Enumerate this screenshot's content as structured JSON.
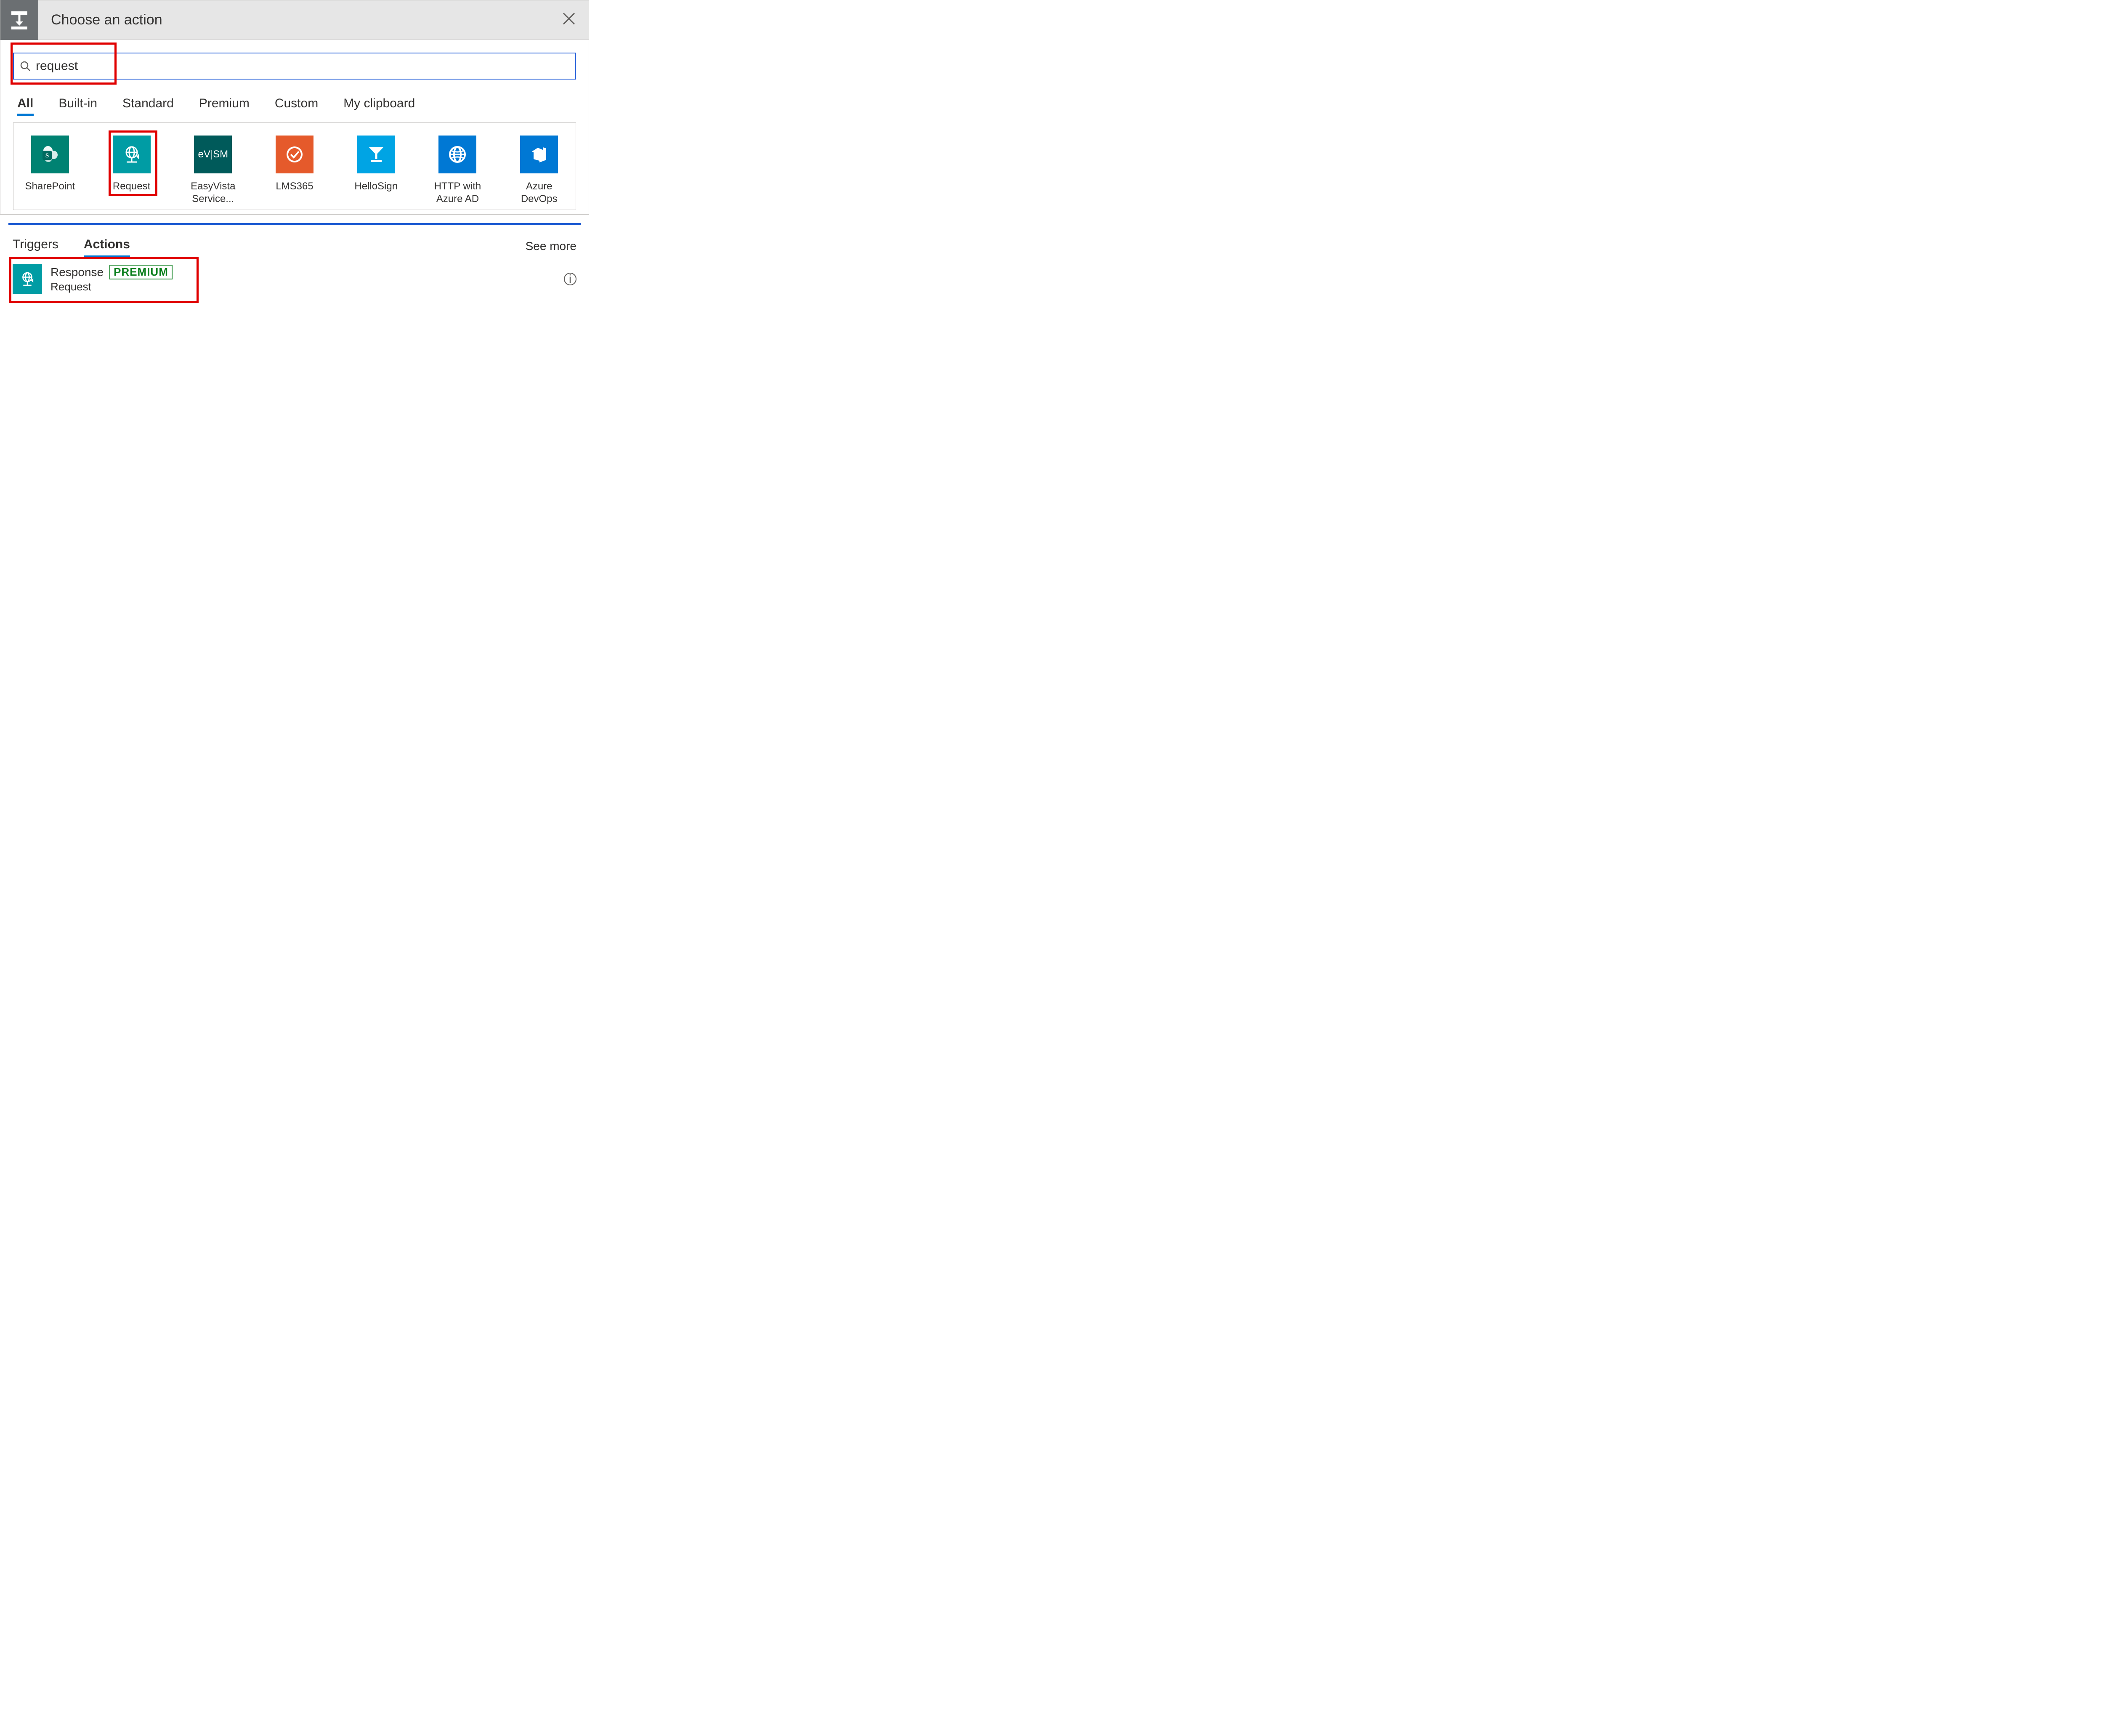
{
  "header": {
    "title": "Choose an action",
    "header_icon": "insert-step-icon",
    "close_icon": "close-icon"
  },
  "search": {
    "value": "request",
    "placeholder": ""
  },
  "filter_tabs": [
    "All",
    "Built-in",
    "Standard",
    "Premium",
    "Custom",
    "My clipboard"
  ],
  "filter_selected": "All",
  "connectors": [
    {
      "label": "SharePoint",
      "tile_class": "sp-bg",
      "icon": "sharepoint-icon"
    },
    {
      "label": "Request",
      "tile_class": "req-bg",
      "icon": "globe-request-icon",
      "highlight": true
    },
    {
      "label": "EasyVista Service...",
      "tile_class": "ev-bg",
      "icon": "easyvista-icon"
    },
    {
      "label": "LMS365",
      "tile_class": "lms-bg",
      "icon": "lms365-icon"
    },
    {
      "label": "HelloSign",
      "tile_class": "hs-bg",
      "icon": "hellosign-icon"
    },
    {
      "label": "HTTP with Azure AD",
      "tile_class": "http-bg",
      "icon": "globe-icon"
    },
    {
      "label": "Azure DevOps",
      "tile_class": "devops-bg",
      "icon": "azure-devops-icon"
    }
  ],
  "result_tabs": {
    "triggers": "Triggers",
    "actions": "Actions",
    "see_more": "See more"
  },
  "result_tab_selected": "Actions",
  "actions": [
    {
      "title": "Response",
      "subtitle": "Request",
      "premium": "PREMIUM",
      "icon": "globe-request-icon",
      "highlight": true
    }
  ]
}
